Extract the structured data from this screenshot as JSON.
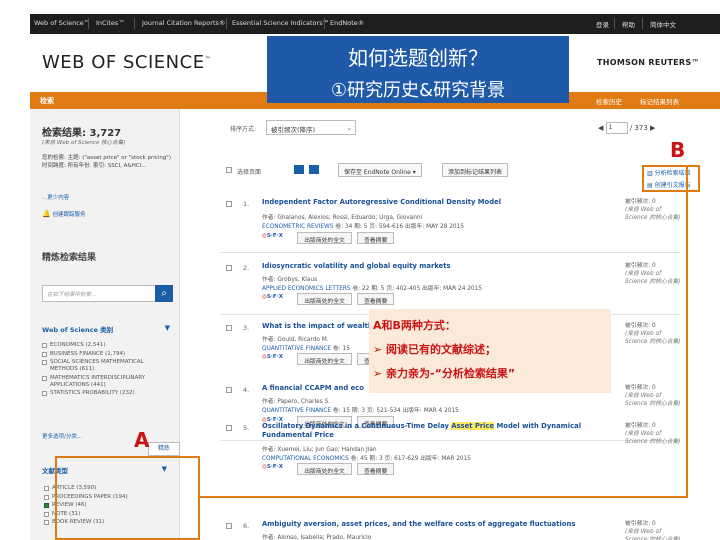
{
  "topbar": {
    "links": [
      "Web of Science™",
      "InCites™",
      "Journal Citation Reports®",
      "Essential Science Indicators℠",
      "EndNote®"
    ],
    "right": [
      "登录",
      "帮助",
      "简体中文"
    ]
  },
  "header": {
    "logo": "WEB OF SCIENCE",
    "logo_tm": "™",
    "brand": "THOMSON REUTERS™"
  },
  "title_box": {
    "line1": "如何选题创新？",
    "line2": "①研究历史&研究背景"
  },
  "navbar": {
    "left": "检索",
    "right": [
      "检索历史",
      "标记结果列表"
    ]
  },
  "sidebar": {
    "result_count": "检索结果: 3,727",
    "source": "(来自 Web of Science 核心合集)",
    "query": "您的检索: 主题: (\"asset price\" or \"stock pricing\") 时间跨度: 所有年份. 索引: SSCI, A&HCI...",
    "more": "...更少内容",
    "alert": "创建跟踪服务",
    "refine_title": "精炼检索结果",
    "search_placeholder": "在如下结果中检索...",
    "category_header": "Web of Science 类别",
    "categories": [
      "ECONOMICS (2,541)",
      "BUSINESS FINANCE (1,794)",
      "SOCIAL SCIENCES MATHEMATICAL METHODS (611)",
      "MATHEMATICS INTERDISCIPLINARY APPLICATIONS (441)",
      "STATISTICS PROBABILITY (232)"
    ],
    "more_categories": "更多选项/分类...",
    "refine_button": "精炼",
    "doctype_header": "文献类型",
    "doctypes": [
      {
        "label": "ARTICLE (3,590)",
        "checked": false
      },
      {
        "label": "PROCEEDINGS PAPER (194)",
        "checked": false
      },
      {
        "label": "REVIEW (46)",
        "checked": true
      },
      {
        "label": "NOTE (31)",
        "checked": false
      },
      {
        "label": "BOOK REVIEW (31)",
        "checked": false
      }
    ]
  },
  "sortbar": {
    "label": "排序方式:",
    "selected": "被引频次(降序)",
    "page": "1",
    "page_total": "/ 373",
    "prev": "◀",
    "next": "▶"
  },
  "toolbar": {
    "select_page": "选择页面",
    "endnote": "保存至 EndNote Online",
    "add_marked": "添加到标记结果列表",
    "analyze": "分析检索结果",
    "citation_report": "创建引文报告"
  },
  "records": [
    {
      "num": "1.",
      "title": "Independent Factor Autoregressive Conditional Density Model",
      "authors": "作者: Ghalanos, Alexios; Rossi, Eduardo; Urga, Giovanni",
      "source": "ECONOMETRIC REVIEWS",
      "meta": " 卷: 34  期: 5  页: 594-616  出版年: MAY 28 2015",
      "full_text": "出版商处的全文",
      "abstract": "查看摘要",
      "cited": "被引频次: 0",
      "cited_src": "(来自 Web of Science 的核心合集)"
    },
    {
      "num": "2.",
      "title": "Idiosyncratic volatility and global equity markets",
      "authors": "作者: Grobys, Klaus",
      "source": "APPLIED ECONOMICS LETTERS",
      "meta": " 卷: 22  期: 5  页: 402-405  出版年: MAR 24 2015",
      "full_text": "出版商处的全文",
      "abstract": "查看摘要",
      "cited": "被引频次: 0",
      "cited_src": "(来自 Web of Science 的核心合集)"
    },
    {
      "num": "3.",
      "title": "What is the impact of wealth",
      "authors": "作者: Gould, Ricardo M.",
      "source": "QUANTITATIVE FINANCE",
      "meta": " 卷: 15",
      "full_text": "出版商处的全文",
      "abstract": "查看摘要",
      "cited": "被引频次: 0",
      "cited_src": "(来自 Web of Science 的核心合集)"
    },
    {
      "num": "4.",
      "title": "A financial CCAPM and eco",
      "authors": "作者: Papero, Charles S.",
      "source": "QUANTITATIVE FINANCE",
      "meta": " 卷: 15  期: 3  页: 521-534  出版年: MAR 4 2015",
      "full_text": "出版商处的全文",
      "abstract": "查看摘要",
      "cited": "被引频次: 0",
      "cited_src": "(来自 Web of Science 的核心合集)"
    },
    {
      "num": "5.",
      "title_pre": "Oscillatory Dynamics in a Continuous-Time Delay ",
      "title_hl": "Asset Price",
      "title_post": " Model with Dynamical Fundamental Price",
      "authors": "作者: Xuemei, Liu; Jun Gao; Handan Jian",
      "source": "COMPUTATIONAL ECONOMICS",
      "meta": " 卷: 45  期: 3  页: 617-629  出版年: MAR 2015",
      "full_text": "出版商处的全文",
      "abstract": "查看摘要",
      "cited": "被引频次: 0",
      "cited_src": "(来自 Web of Science 的核心合集)"
    },
    {
      "num": "6.",
      "title": "Ambiguity aversion, asset prices, and the welfare costs of aggregate fluctuations",
      "authors": "作者: Alonso, Isabella; Prado, Mauricio",
      "cited": "被引频次: 0",
      "cited_src": "(来自 Web of Science 的核心合集)"
    }
  ],
  "annotation": {
    "heading": "A和B两种方式：",
    "item1": "➢  阅读已有的文献综述；",
    "item2": "➢  亲力亲为-“分析检索结果”"
  },
  "labels": {
    "a": "A",
    "b": "B"
  }
}
